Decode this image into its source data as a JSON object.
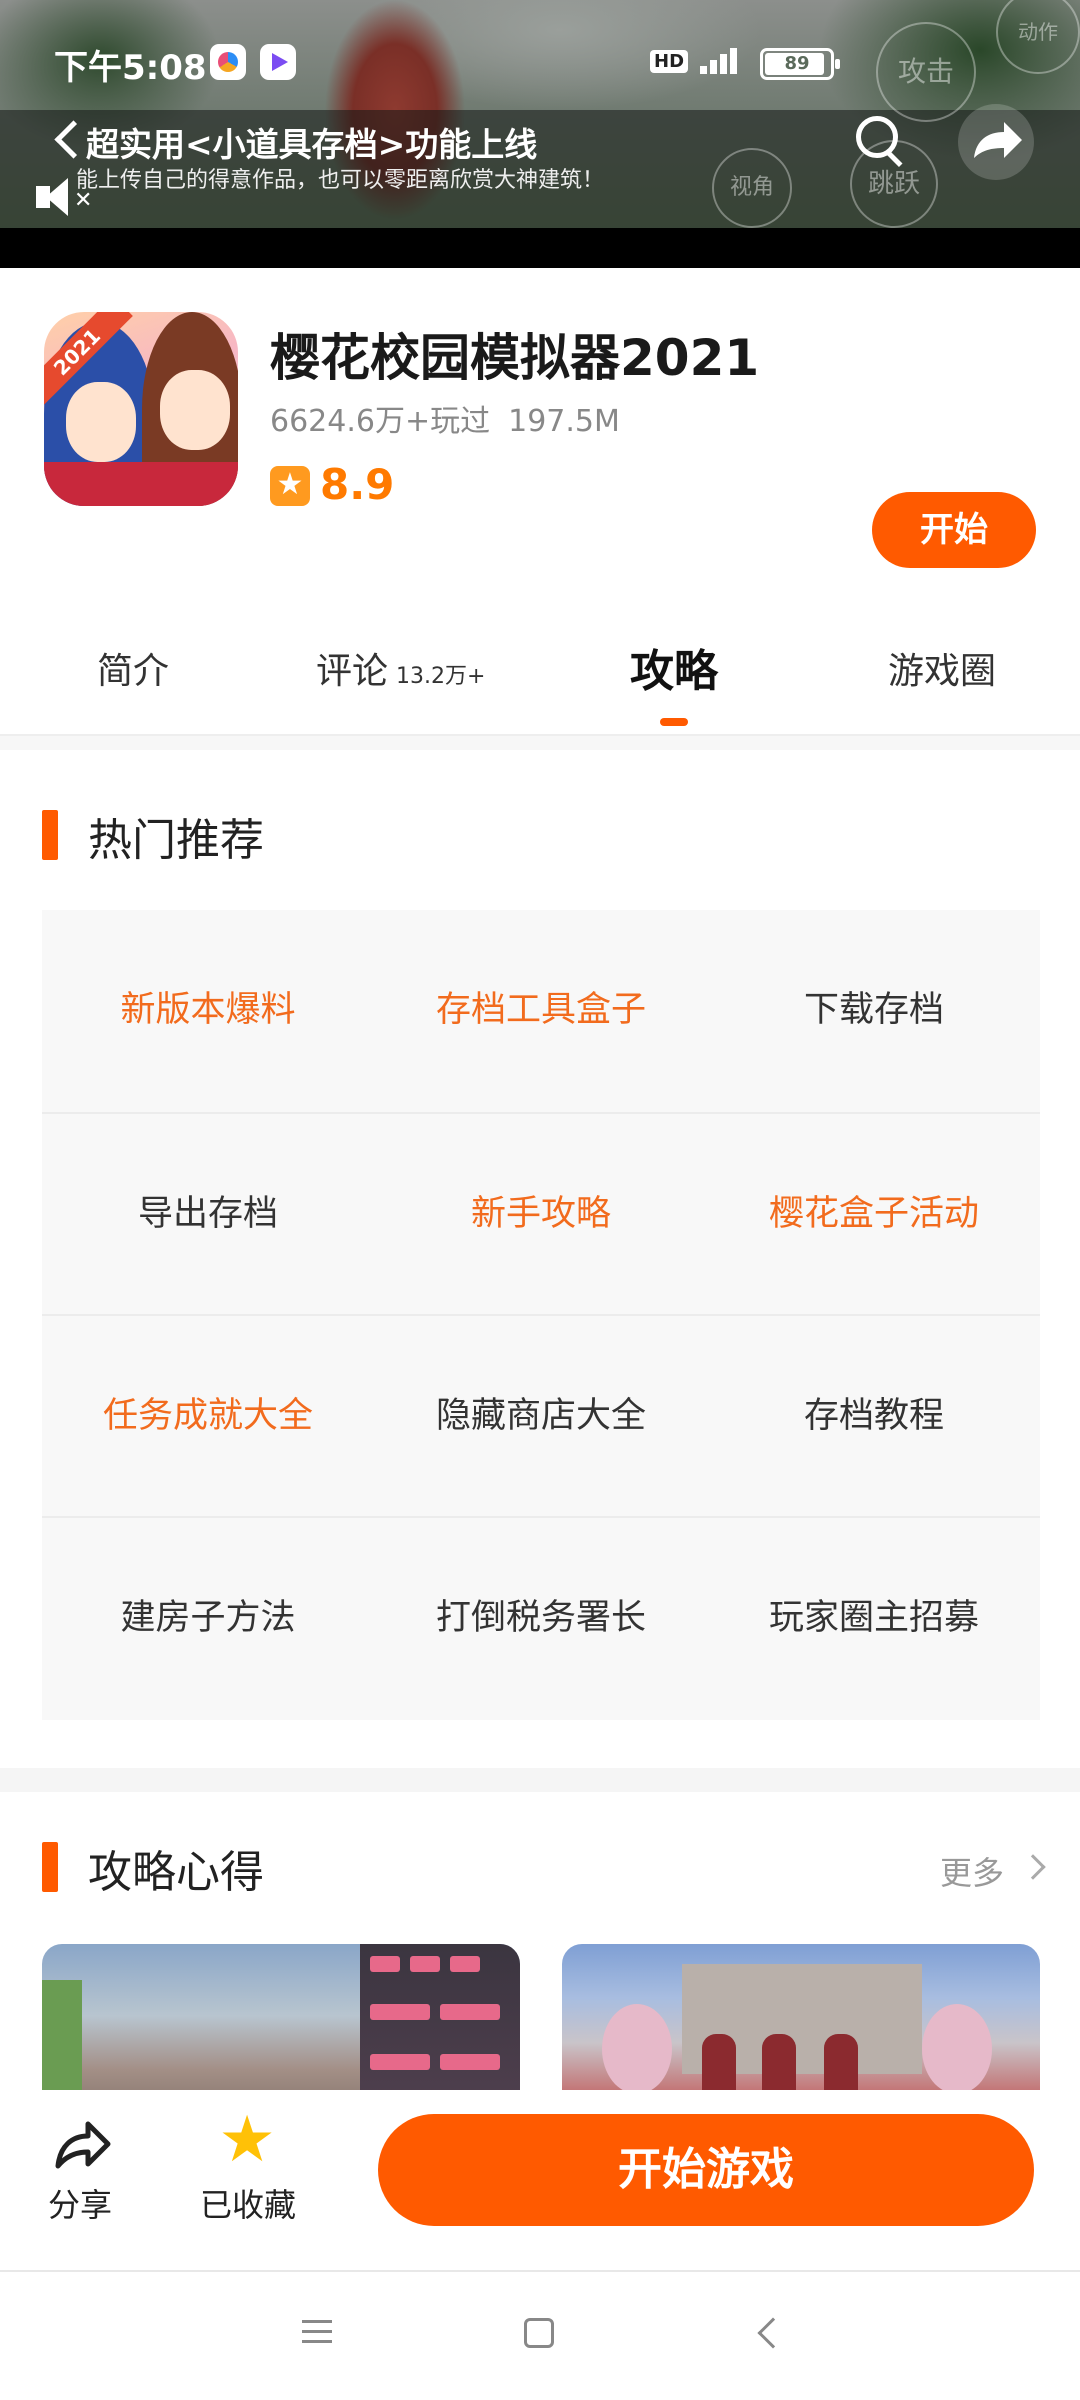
{
  "status_bar": {
    "time": "下午5:08",
    "network": "HD",
    "battery": "89",
    "battery_fraction": 0.89
  },
  "video": {
    "title": "超实用<小道具存档>功能上线",
    "subtitle": "能上传自己的得意作品，也可以零距离欣赏大神建筑！",
    "game_buttons": {
      "attack": "攻击",
      "action": "动作",
      "jump": "跳跃",
      "extra": "视角"
    }
  },
  "app": {
    "icon_badge": "2021",
    "name": "樱花校园模拟器2021",
    "plays": "6624.6万+玩过",
    "size": "197.5M",
    "rating": "8.9",
    "start_label": "开始"
  },
  "tabs": [
    {
      "label": "简介",
      "sub": ""
    },
    {
      "label": "评论",
      "sub": "13.2万+"
    },
    {
      "label": "攻略",
      "sub": ""
    },
    {
      "label": "游戏圈",
      "sub": ""
    }
  ],
  "active_tab": "攻略",
  "hot": {
    "title": "热门推荐",
    "items": [
      {
        "label": "新版本爆料",
        "highlight": true
      },
      {
        "label": "存档工具盒子",
        "highlight": true
      },
      {
        "label": "下载存档",
        "highlight": false
      },
      {
        "label": "导出存档",
        "highlight": false
      },
      {
        "label": "新手攻略",
        "highlight": true
      },
      {
        "label": "樱花盒子活动",
        "highlight": true
      },
      {
        "label": "任务成就大全",
        "highlight": true
      },
      {
        "label": "隐藏商店大全",
        "highlight": false
      },
      {
        "label": "存档教程",
        "highlight": false
      },
      {
        "label": "建房子方法",
        "highlight": false
      },
      {
        "label": "打倒税务署长",
        "highlight": false
      },
      {
        "label": "玩家圈主招募",
        "highlight": false
      }
    ]
  },
  "guides": {
    "title": "攻略心得",
    "more": "更多"
  },
  "bottom": {
    "share": "分享",
    "favorite": "已收藏",
    "start_game": "开始游戏"
  },
  "colors": {
    "accent": "#ff5a00",
    "highlight_text": "#f26b1d",
    "rating": "#ff7a00",
    "favorite_star": "#ffc107"
  }
}
